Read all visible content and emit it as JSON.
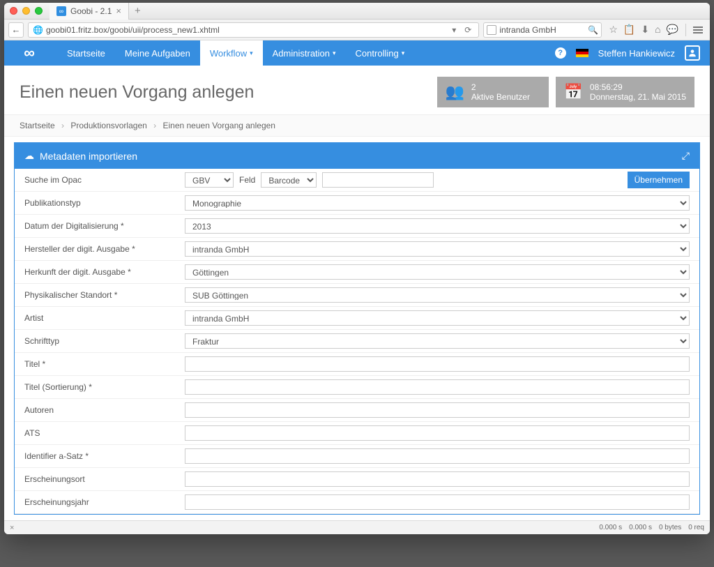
{
  "browser": {
    "tab_title": "Goobi - 2.1",
    "url": "goobi01.fritz.box/goobi/uii/process_new1.xhtml",
    "search_value": "intranda GmbH"
  },
  "nav": {
    "home": "Startseite",
    "tasks": "Meine Aufgaben",
    "workflow": "Workflow",
    "admin": "Administration",
    "controlling": "Controlling",
    "username": "Steffen Hankiewicz"
  },
  "page_title": "Einen neuen Vorgang anlegen",
  "stat_users": {
    "count": "2",
    "label": "Aktive Benutzer"
  },
  "stat_time": {
    "time": "08:56:29",
    "date": "Donnerstag, 21. Mai 2015"
  },
  "breadcrumb": {
    "a": "Startseite",
    "b": "Produktionsvorlagen",
    "c": "Einen neuen Vorgang anlegen"
  },
  "panel_title": "Metadaten importieren",
  "opac": {
    "label": "Suche im Opac",
    "catalog": "GBV",
    "field_label": "Feld",
    "field": "Barcode",
    "value": "",
    "submit": "Übernehmen"
  },
  "fields": {
    "pubtype": {
      "label": "Publikationstyp",
      "value": "Monographie"
    },
    "digidate": {
      "label": "Datum der Digitalisierung *",
      "value": "2013"
    },
    "producer": {
      "label": "Hersteller der digit. Ausgabe *",
      "value": "intranda GmbH"
    },
    "origin": {
      "label": "Herkunft der digit. Ausgabe *",
      "value": "Göttingen"
    },
    "location": {
      "label": "Physikalischer Standort *",
      "value": "SUB Göttingen"
    },
    "artist": {
      "label": "Artist",
      "value": "intranda GmbH"
    },
    "fonttype": {
      "label": "Schrifttyp",
      "value": "Fraktur"
    },
    "title": {
      "label": "Titel *",
      "value": ""
    },
    "title_sort": {
      "label": "Titel (Sortierung) *",
      "value": ""
    },
    "authors": {
      "label": "Autoren",
      "value": ""
    },
    "ats": {
      "label": "ATS",
      "value": ""
    },
    "ident_a": {
      "label": "Identifier a-Satz *",
      "value": ""
    },
    "pubplace": {
      "label": "Erscheinungsort",
      "value": ""
    },
    "pubyear": {
      "label": "Erscheinungsjahr",
      "value": ""
    }
  },
  "footer": {
    "t1": "0.000 s",
    "t2": "0.000 s",
    "bytes": "0 bytes",
    "req": "0 req"
  }
}
